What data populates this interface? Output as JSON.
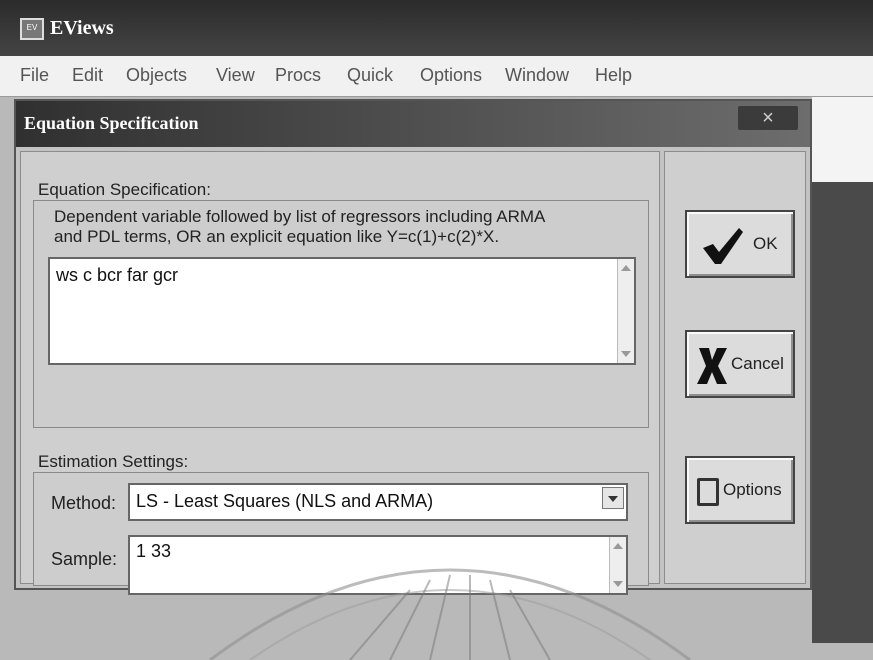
{
  "app": {
    "title": "EViews",
    "menu": [
      "File",
      "Edit",
      "Objects",
      "View",
      "Procs",
      "Quick",
      "Options",
      "Window",
      "Help"
    ]
  },
  "dialog": {
    "title": "Equation Specification",
    "close_label": "×",
    "equation_group_label": "Equation Specification:",
    "description_line1": "Dependent variable followed by list of regressors including ARMA",
    "description_line2": "and PDL terms, OR an explicit equation like Y=c(1)+c(2)*X.",
    "equation_value": "ws c bcr far gcr",
    "estimation_group_label": "Estimation Settings:",
    "method_label": "Method:",
    "method_value": "LS  -  Least Squares (NLS and ARMA)",
    "sample_label": "Sample:",
    "sample_value": "1 33",
    "buttons": {
      "ok": "OK",
      "cancel": "Cancel",
      "options": "Options"
    }
  }
}
